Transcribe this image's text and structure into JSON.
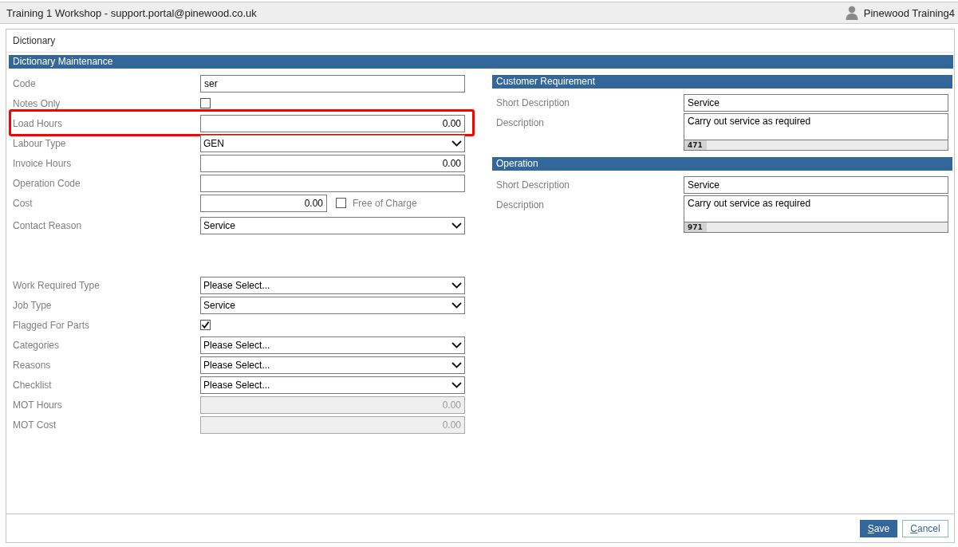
{
  "window": {
    "title": "Training 1 Workshop - support.portal@pinewood.co.uk",
    "user": "Pinewood Training4"
  },
  "panel": {
    "title": "Dictionary"
  },
  "section": {
    "title": "Dictionary Maintenance"
  },
  "field_groups": [
    {
      "fields": [
        {
          "kind": "text",
          "label": "Code",
          "value": "ser",
          "disabled": false,
          "highlighted": false
        },
        {
          "kind": "checkbox",
          "label": "Notes Only",
          "checked": false,
          "disabled": false,
          "highlighted": false
        },
        {
          "kind": "number",
          "label": "Load Hours",
          "value": "0.00",
          "disabled": false,
          "highlighted": true
        },
        {
          "kind": "select",
          "label": "Labour Type",
          "value": "GEN",
          "disabled": false,
          "highlighted": false
        },
        {
          "kind": "number",
          "label": "Invoice Hours",
          "value": "0.00",
          "disabled": false,
          "highlighted": false
        },
        {
          "kind": "text",
          "label": "Operation Code",
          "disabled": false,
          "highlighted": false
        },
        {
          "kind": "cost",
          "label": "Cost",
          "value": "0.00",
          "disabled": false,
          "highlighted": false,
          "option": {
            "label": "Free of Charge",
            "checked": false
          }
        },
        {
          "kind": "select",
          "label": "Contact Reason",
          "value": "Service",
          "disabled": false,
          "highlighted": false
        }
      ]
    },
    {
      "fields": [
        {
          "kind": "select",
          "label": "Work Required Type",
          "value": "Please Select...",
          "disabled": false,
          "highlighted": false
        },
        {
          "kind": "select",
          "label": "Job Type",
          "value": "Service",
          "disabled": false,
          "highlighted": false
        },
        {
          "kind": "checkbox",
          "label": "Flagged For Parts",
          "checked": true,
          "disabled": false,
          "highlighted": false
        },
        {
          "kind": "select",
          "label": "Categories",
          "value": "Please Select...",
          "disabled": false,
          "highlighted": false
        },
        {
          "kind": "select",
          "label": "Reasons",
          "value": "Please Select...",
          "disabled": false,
          "highlighted": false
        },
        {
          "kind": "select",
          "label": "Checklist",
          "value": "Please Select...",
          "disabled": false,
          "highlighted": false
        },
        {
          "kind": "number",
          "label": "MOT Hours",
          "value": "0.00",
          "disabled": true,
          "highlighted": false
        },
        {
          "kind": "number",
          "label": "MOT Cost",
          "value": "0.00",
          "disabled": true,
          "highlighted": false
        }
      ]
    }
  ],
  "panels": [
    {
      "title": "Customer Requirement",
      "short_description": {
        "label": "Short Description",
        "value": "Service"
      },
      "description": {
        "label": "Description",
        "value": "Carry out service as required",
        "count": "471"
      }
    },
    {
      "title": "Operation",
      "short_description": {
        "label": "Short Description",
        "value": "Service"
      },
      "description": {
        "label": "Description",
        "value": "Carry out service as required",
        "count": "971"
      }
    }
  ],
  "buttons": [
    {
      "label": "Save",
      "kind": "primary"
    },
    {
      "label": "Cancel",
      "kind": "secondary"
    }
  ]
}
